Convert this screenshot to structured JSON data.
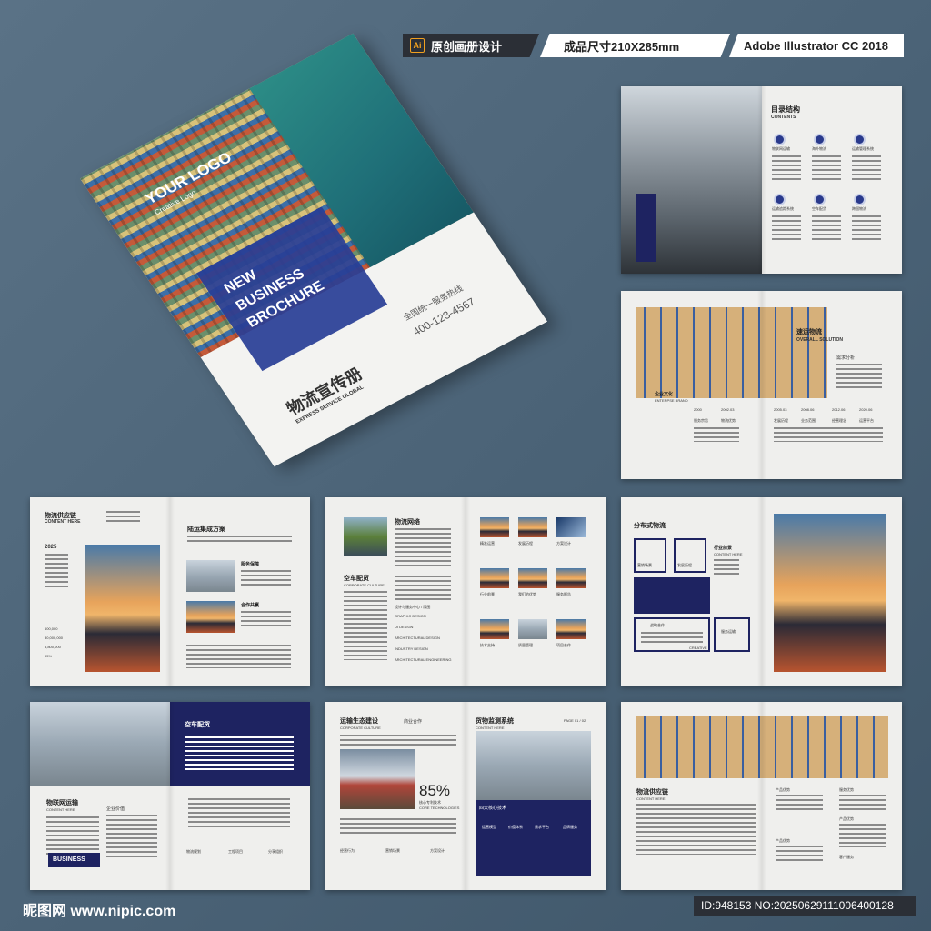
{
  "badges": {
    "b1": "原创画册设计",
    "b2": "成品尺寸210X285mm",
    "b3": "Adobe Illustrator CC 2018",
    "ai_icon": "Ai"
  },
  "cover": {
    "logo": "YOUR LOGO",
    "logo_sub": "Creative Logo",
    "title1": "NEW",
    "title2": "BUSINESS",
    "title3": "BROCHURE",
    "cn_title": "物流宣传册",
    "en_sub": "EXPRESS SERVICE GLOBAL",
    "hotline": "全国统一服务热线",
    "phone": "400-123-4567"
  },
  "s1": {
    "title": "目录结构",
    "sub": "CONTENTS",
    "items": [
      "物联网运输",
      "海外物流",
      "运输管理系统",
      "运输追踪系统",
      "空车配货",
      "跨国物流"
    ]
  },
  "s2": {
    "title": "速运物流",
    "sub": "OVERALL SOLUTION",
    "need": "需求分析",
    "culture": "企业文化",
    "culture_en": "ENTERPSE BRAND",
    "years": [
      "2000",
      "2002.03",
      "2005.03",
      "2008.06",
      "2012.06",
      "2020.06"
    ],
    "labels": [
      "服务宗旨",
      "物流优势",
      "发展历程",
      "业务范围",
      "经营理念",
      "运营平台"
    ]
  },
  "s3": {
    "title": "物流供应链",
    "sub": "CONTENT HERE",
    "year": "2025",
    "right_title": "陆运集成方案",
    "a": "服务保障",
    "b": "合作共赢",
    "stats": [
      "600,000",
      "80,000,000",
      "5,800,000",
      "95%"
    ]
  },
  "s4": {
    "title": "物流网络",
    "title2": "空车配货",
    "sub2": "CORPORATE CULTURE",
    "items": [
      "精准运营",
      "发展历程",
      "方案设计",
      "行业前景",
      "我们的优势",
      "服务报告",
      "技术支持",
      "质量管理",
      "项目合作"
    ],
    "lines": [
      "设计与服务中心 / 版图",
      "GRAPHIC DESIGN",
      "UI DESIGN",
      "ARCHITECTURAL DESIGN",
      "INDUSTRY DESIGN",
      "ARCHITECTURAL ENGINEERING"
    ]
  },
  "s5": {
    "title": "分布式物流",
    "a": "营销场景",
    "b": "发展历程",
    "c": "行业前景",
    "c_sub": "CONTENT HERE",
    "d": "战略合作",
    "e": "服务运输",
    "creative": "CREATIVE"
  },
  "s6": {
    "title": "物联网运输",
    "sub": "CONTENT HERE",
    "sub2": "企业价值",
    "panel": "空车配货",
    "business": "BUSINESS",
    "icons": [
      "物流规划",
      "工程项目",
      "分享组织"
    ]
  },
  "s7": {
    "title": "运输生态建设",
    "sub": "CORPORATE CULTURE",
    "coop": "商业合作",
    "pct": "85%",
    "pct_label": "核心专利技术",
    "pct_en": "CORE TECHNOLOGIES",
    "title2": "货物监测系统",
    "sub2": "CONTENT HERE",
    "page": "PAGE 01 / 02",
    "tech": "四大核心技术",
    "bottom": [
      "经营行为",
      "营销场景",
      "方案设计"
    ],
    "techs": [
      "运营模型",
      "价值体系",
      "需求平台",
      "品牌服务"
    ]
  },
  "s8": {
    "title": "物流供应链",
    "sub": "CONTENT HERE",
    "labels": [
      "产品优势",
      "服务优势",
      "产品优势",
      "产品优势",
      "客户服务"
    ]
  },
  "footer": {
    "left": "昵图网 www.nipic.com",
    "right": "ID:948153 NO:20250629111006400128"
  }
}
